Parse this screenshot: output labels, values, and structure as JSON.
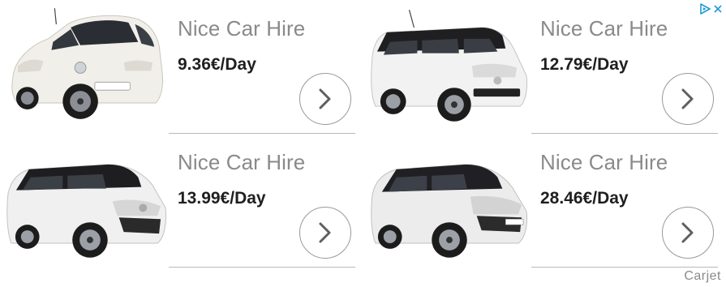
{
  "ads": [
    {
      "brand": "Nice Car Hire",
      "price": "9.36€/Day",
      "car_icon": "white-hatchback-car-image",
      "car_color": "#f1efe9"
    },
    {
      "brand": "Nice Car Hire",
      "price": "12.79€/Day",
      "car_icon": "white-mpv-black-roof-car-image",
      "car_color": "#f2f2f2"
    },
    {
      "brand": "Nice Car Hire",
      "price": "13.99€/Day",
      "car_icon": "white-compact-suv-car-image",
      "car_color": "#f0f0f0"
    },
    {
      "brand": "Nice Car Hire",
      "price": "28.46€/Day",
      "car_icon": "white-large-suv-car-image",
      "car_color": "#ececec"
    }
  ],
  "adchoices": {
    "icon": "adchoices-triangle-icon",
    "close_icon": "close-x-icon",
    "color": "#1e9bd7"
  },
  "footer": {
    "brand": "Carjet"
  }
}
